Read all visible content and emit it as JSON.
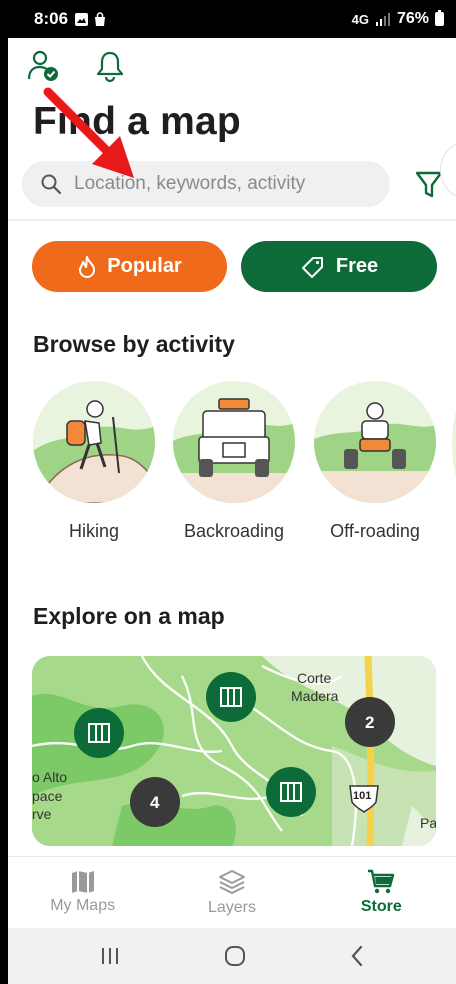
{
  "status_bar": {
    "time": "8:06",
    "network": "4G",
    "battery": "76%"
  },
  "header": {
    "title": "Find a map"
  },
  "search": {
    "placeholder": "Location, keywords, activity"
  },
  "chips": {
    "popular": "Popular",
    "free": "Free"
  },
  "sections": {
    "browse": "Browse by activity",
    "explore": "Explore on a map"
  },
  "activities": [
    {
      "label": "Hiking"
    },
    {
      "label": "Backroading"
    },
    {
      "label": "Off-roading"
    }
  ],
  "map": {
    "place_labels": [
      "Corte",
      "Madera",
      "o Alto",
      "pace",
      "rve",
      "Pa"
    ],
    "cluster_counts": [
      "2",
      "4"
    ],
    "highway_shield": "101"
  },
  "bottom_nav": [
    {
      "label": "My Maps",
      "icon": "map-icon",
      "active": false
    },
    {
      "label": "Layers",
      "icon": "layers-icon",
      "active": false
    },
    {
      "label": "Store",
      "icon": "cart-icon",
      "active": true
    }
  ],
  "colors": {
    "primary_green": "#0d6b3a",
    "popular_orange": "#f06a1b",
    "annotation_red": "#e8191b"
  }
}
